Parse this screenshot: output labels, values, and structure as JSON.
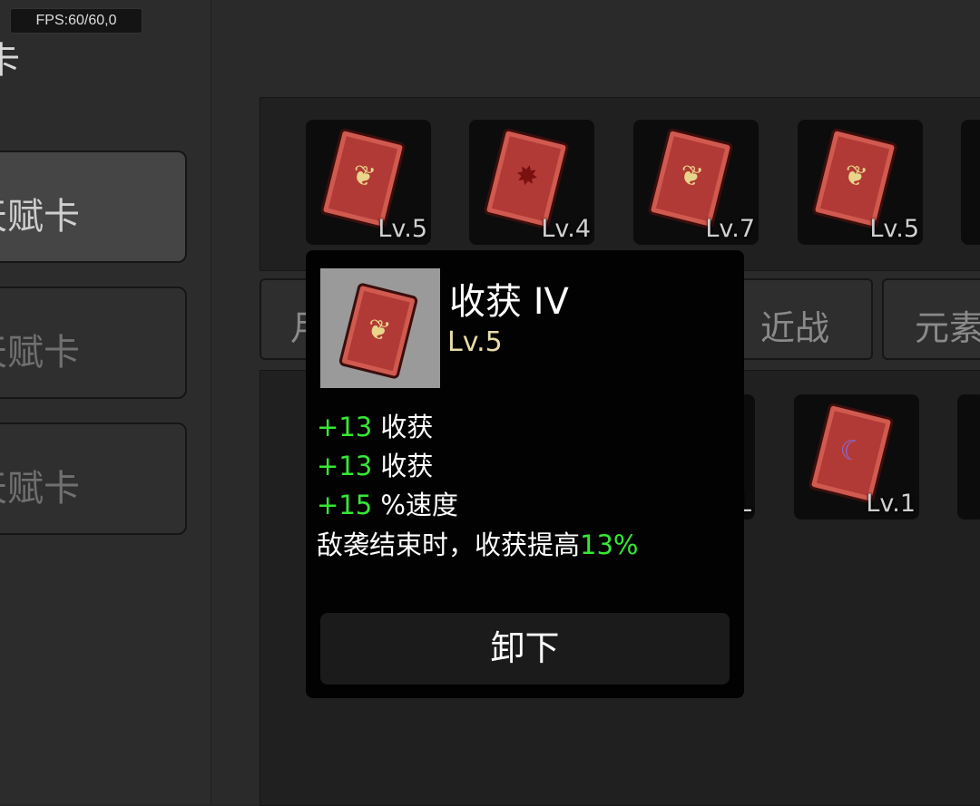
{
  "hud": {
    "fps": "FPS:60/60,0"
  },
  "sidebar": {
    "title": "卡",
    "items": [
      {
        "label": "天赋卡"
      },
      {
        "label": "天赋卡"
      },
      {
        "label": "天赋卡"
      }
    ]
  },
  "equipped_slots": [
    {
      "icon": "harvest-card-icon",
      "level": "Lv.5"
    },
    {
      "icon": "burst-card-icon",
      "level": "Lv.4"
    },
    {
      "icon": "harvest-card-icon",
      "level": "Lv.7"
    },
    {
      "icon": "harvest-card-icon",
      "level": "Lv.5"
    }
  ],
  "filter_tabs": [
    {
      "label": "月"
    },
    {
      "label": "近战"
    },
    {
      "label": "元素"
    }
  ],
  "inventory_slots": [
    {
      "icon": "card-icon",
      "level": "L"
    },
    {
      "icon": "crescent-card-icon",
      "level": "Lv.1"
    }
  ],
  "tooltip": {
    "title": "收获 IV",
    "level": "Lv.5",
    "icon": "harvest-card-icon",
    "stats": [
      {
        "value": "+13",
        "label": "收获"
      },
      {
        "value": "+13",
        "label": "收获"
      },
      {
        "value": "+15",
        "label": "%速度"
      }
    ],
    "effect_text": "敌袭结束时，收获提高",
    "effect_value": "13%",
    "unequip_label": "卸下"
  },
  "colors": {
    "positive": "#35e835",
    "level": "#e7dca7",
    "card": "#b23a36"
  }
}
